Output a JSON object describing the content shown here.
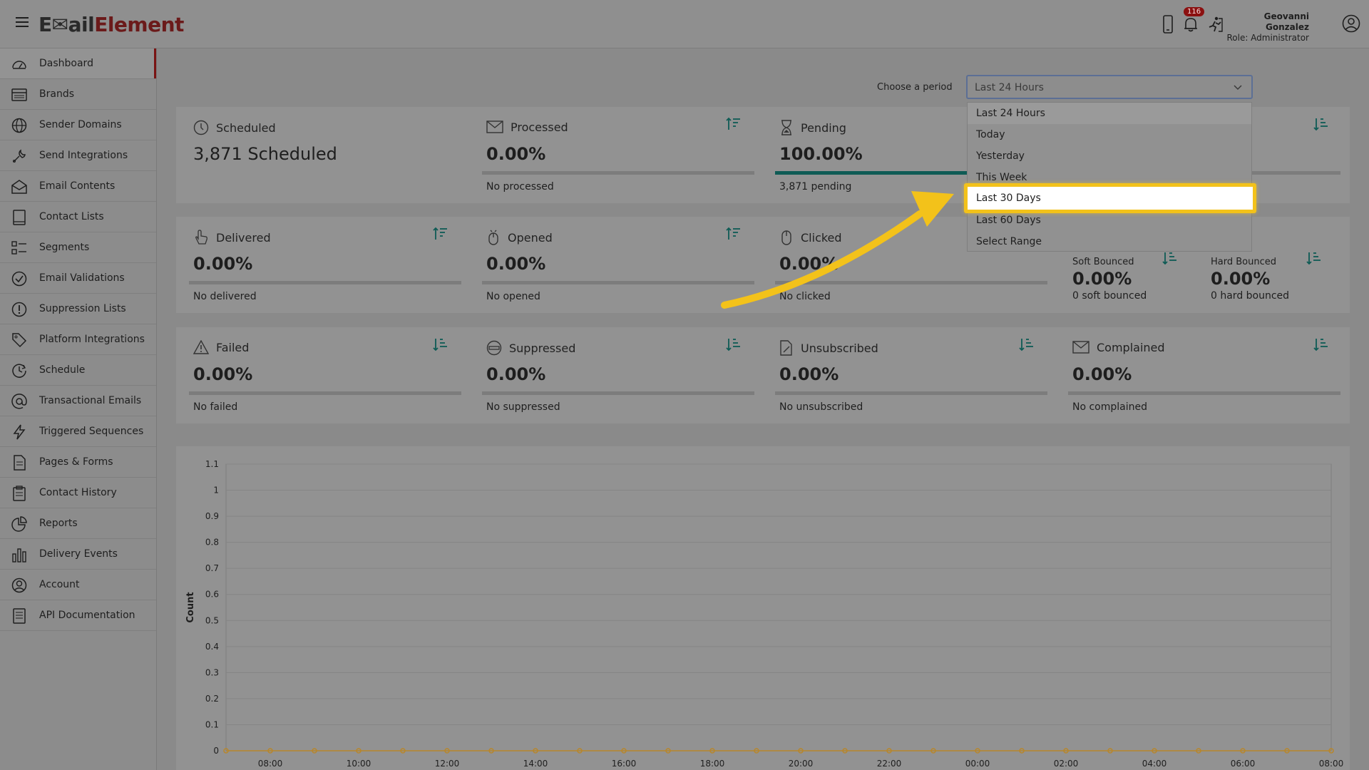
{
  "app": {
    "logo_part1": "E",
    "logo_part2": "ail",
    "logo_part3": "Element"
  },
  "header": {
    "badge_count": "116",
    "user_name": "Geovanni Gonzalez",
    "user_role": "Role: Administrator",
    "icons": [
      "mobile-icon",
      "bell-icon",
      "exit-icon",
      "user-circle-icon"
    ]
  },
  "sidebar": {
    "items": [
      {
        "label": "Dashboard",
        "icon": "speedometer-icon"
      },
      {
        "label": "Brands",
        "icon": "card-icon"
      },
      {
        "label": "Sender Domains",
        "icon": "globe-icon"
      },
      {
        "label": "Send Integrations",
        "icon": "wrench-icon"
      },
      {
        "label": "Email Contents",
        "icon": "envelope-open-icon"
      },
      {
        "label": "Contact Lists",
        "icon": "book-icon"
      },
      {
        "label": "Segments",
        "icon": "list-icon"
      },
      {
        "label": "Email Validations",
        "icon": "check-circle-icon"
      },
      {
        "label": "Suppression Lists",
        "icon": "exclamation-circle-icon"
      },
      {
        "label": "Platform Integrations",
        "icon": "tag-icon"
      },
      {
        "label": "Schedule",
        "icon": "clock-arrow-icon"
      },
      {
        "label": "Transactional Emails",
        "icon": "at-icon"
      },
      {
        "label": "Triggered Sequences",
        "icon": "lightning-icon"
      },
      {
        "label": "Pages & Forms",
        "icon": "file-icon"
      },
      {
        "label": "Contact History",
        "icon": "clipboard-icon"
      },
      {
        "label": "Reports",
        "icon": "pie-chart-icon"
      },
      {
        "label": "Delivery Events",
        "icon": "bar-chart-icon"
      },
      {
        "label": "Account",
        "icon": "person-circle-icon"
      },
      {
        "label": "API Documentation",
        "icon": "document-list-icon"
      }
    ]
  },
  "period": {
    "label": "Choose a period",
    "selected": "Last 24 Hours",
    "options": [
      "Last 24 Hours",
      "Today",
      "Yesterday",
      "This Week",
      "Last 30 Days",
      "Last 60 Days",
      "Select Range"
    ],
    "highlighted": "Last 30 Days"
  },
  "cards": {
    "scheduled": {
      "title": "Scheduled",
      "value": "3,871 Scheduled"
    },
    "processed": {
      "title": "Processed",
      "value": "0.00%",
      "sub": "No processed",
      "fill": 0
    },
    "pending": {
      "title": "Pending",
      "value": "100.00%",
      "sub": "3,871 pending",
      "fill": 1
    },
    "delivered": {
      "title": "Delivered",
      "value": "0.00%",
      "sub": "No delivered",
      "fill": 0
    },
    "opened": {
      "title": "Opened",
      "value": "0.00%",
      "sub": "No opened",
      "fill": 0
    },
    "clicked": {
      "title": "Clicked",
      "value": "0.00%",
      "sub": "No clicked",
      "fill": 0
    },
    "soft_bounced": {
      "title": "Soft Bounced",
      "value": "0.00%",
      "sub": "0 soft bounced"
    },
    "hard_bounced": {
      "title": "Hard Bounced",
      "value": "0.00%",
      "sub": "0 hard bounced"
    },
    "failed": {
      "title": "Failed",
      "value": "0.00%",
      "sub": "No failed",
      "fill": 0
    },
    "suppressed": {
      "title": "Suppressed",
      "value": "0.00%",
      "sub": "No suppressed",
      "fill": 0
    },
    "unsubscribed": {
      "title": "Unsubscribed",
      "value": "0.00%",
      "sub": "No unsubscribed",
      "fill": 0
    },
    "complained": {
      "title": "Complained",
      "value": "0.00%",
      "sub": "No complained",
      "fill": 0
    }
  },
  "colors": {
    "accent_bar": "#0e5b55",
    "highlight_border": "#f3c21a",
    "arrow": "#f3c21a",
    "active_marker": "#7a1414",
    "series_point": "#b8862a"
  },
  "chart_data": {
    "type": "line",
    "ylabel": "Count",
    "xlabel": "",
    "ylim": [
      0,
      1.1
    ],
    "yticks": [
      "0",
      "0.1",
      "0.2",
      "0.3",
      "0.4",
      "0.5",
      "0.6",
      "0.7",
      "0.8",
      "0.9",
      "1",
      "1.1"
    ],
    "x_tick_labels": [
      "08:00",
      "10:00",
      "12:00",
      "14:00",
      "16:00",
      "18:00",
      "20:00",
      "22:00",
      "00:00",
      "02:00",
      "04:00",
      "06:00",
      "08:00"
    ],
    "point_count": 26,
    "series": [
      {
        "values": [
          0,
          0,
          0,
          0,
          0,
          0,
          0,
          0,
          0,
          0,
          0,
          0,
          0,
          0,
          0,
          0,
          0,
          0,
          0,
          0,
          0,
          0,
          0,
          0,
          0,
          0
        ]
      }
    ]
  }
}
